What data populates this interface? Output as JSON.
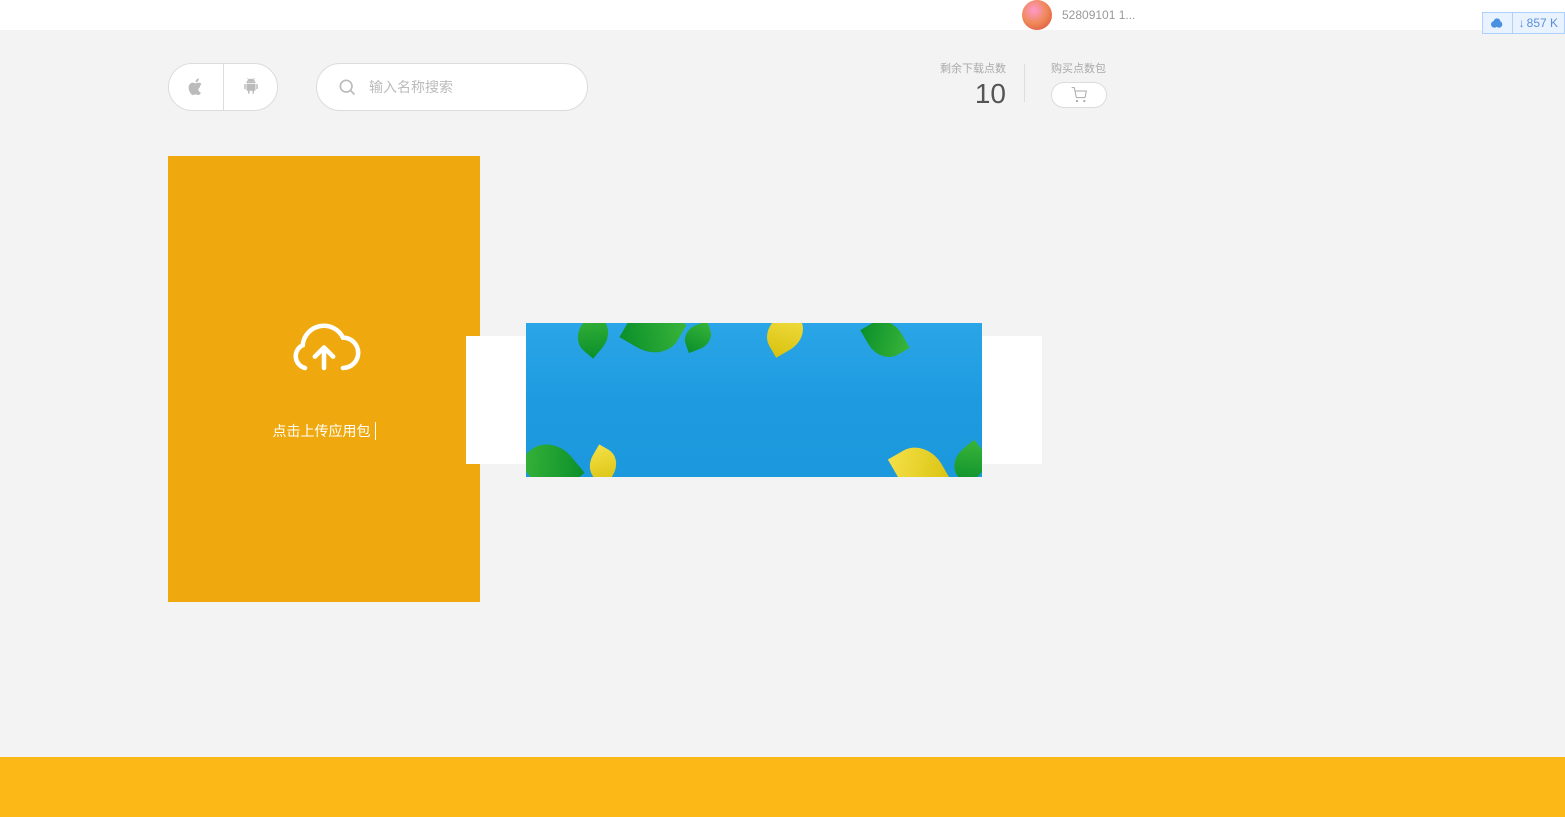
{
  "header": {
    "username": "52809101 1..."
  },
  "widget": {
    "text": "857 K"
  },
  "search": {
    "placeholder": "输入名称搜索"
  },
  "stats": {
    "remaining_label": "剩余下载点数",
    "remaining_value": "10",
    "buy_label": "购买点数包"
  },
  "upload": {
    "text": "点击上传应用包"
  }
}
